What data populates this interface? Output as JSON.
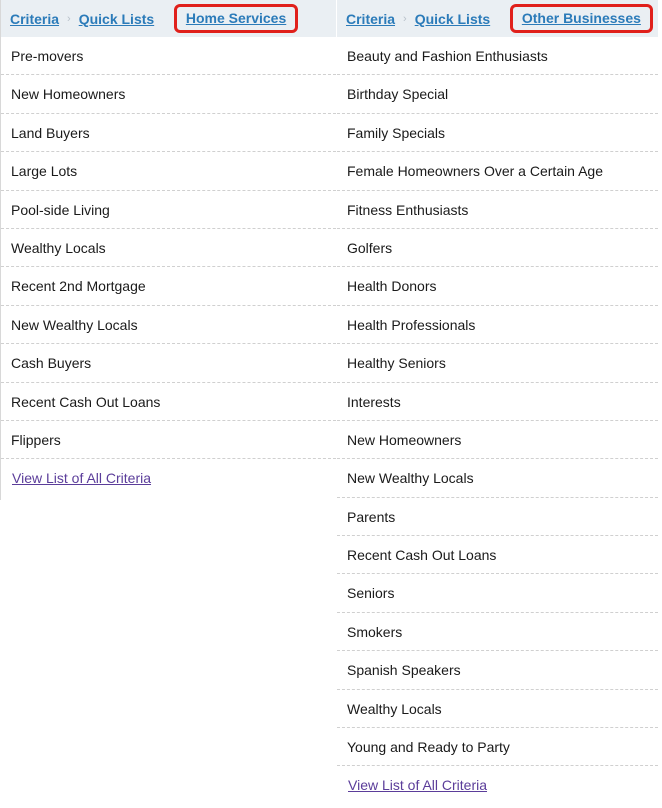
{
  "left_panel": {
    "breadcrumb": {
      "items": [
        "Criteria",
        "Quick Lists"
      ],
      "current": "Home Services",
      "separator": "›"
    },
    "items": [
      "Pre-movers",
      "New Homeowners",
      "Land Buyers",
      "Large Lots",
      "Pool-side Living",
      "Wealthy Locals",
      "Recent 2nd Mortgage",
      "New Wealthy Locals",
      "Cash Buyers",
      "Recent Cash Out Loans",
      "Flippers"
    ],
    "view_all_label": "View List of All Criteria"
  },
  "right_panel": {
    "breadcrumb": {
      "items": [
        "Criteria",
        "Quick Lists"
      ],
      "current": "Other Businesses",
      "separator": "›"
    },
    "items": [
      "Beauty and Fashion Enthusiasts",
      "Birthday Special",
      "Family Specials",
      "Female Homeowners Over a Certain Age",
      "Fitness Enthusiasts",
      "Golfers",
      "Health Donors",
      "Health Professionals",
      "Healthy Seniors",
      "Interests",
      "New Homeowners",
      "New Wealthy Locals",
      "Parents",
      "Recent Cash Out Loans",
      "Seniors",
      "Smokers",
      "Spanish Speakers",
      "Wealthy Locals",
      "Young and Ready to Party"
    ],
    "view_all_label": "View List of All Criteria"
  },
  "colors": {
    "link": "#2b7bb9",
    "visited_link": "#5b3d9a",
    "highlight_border": "#e0201b",
    "header_bg": "#eaeff3"
  }
}
